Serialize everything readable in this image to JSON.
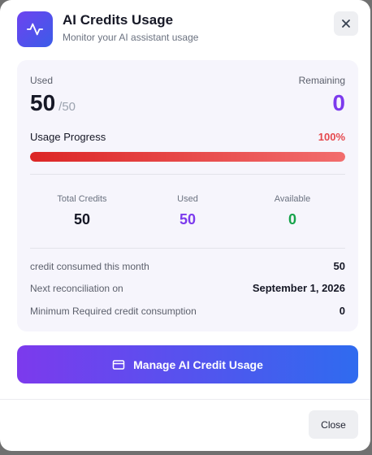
{
  "dialog": {
    "title": "AI Credits Usage",
    "subtitle": "Monitor your AI assistant usage",
    "header_icon": "activity-pulse-icon",
    "close_icon": "close-icon"
  },
  "summary": {
    "used_label": "Used",
    "used_value": "50",
    "used_total": "/50",
    "remaining_label": "Remaining",
    "remaining_value": "0"
  },
  "progress": {
    "label": "Usage Progress",
    "percent_text": "100%",
    "fraction": 1.0
  },
  "stats": [
    {
      "label": "Total Credits",
      "value": "50",
      "color": "#161826"
    },
    {
      "label": "Used",
      "value": "50",
      "color": "#7c3aed"
    },
    {
      "label": "Available",
      "value": "0",
      "color": "#16a34a"
    }
  ],
  "details": [
    {
      "label": "credit consumed this month",
      "value": "50"
    },
    {
      "label": "Next reconciliation on",
      "value": "September 1, 2026"
    },
    {
      "label": "Minimum Required credit consumption",
      "value": "0"
    }
  ],
  "actions": {
    "manage_label": "Manage AI Credit Usage",
    "manage_icon": "credit-card-icon",
    "close_label": "Close"
  },
  "colors": {
    "accent_purple": "#7c3aed",
    "accent_blue": "#2f6bef",
    "danger": "#e5484d",
    "success": "#16a34a"
  }
}
